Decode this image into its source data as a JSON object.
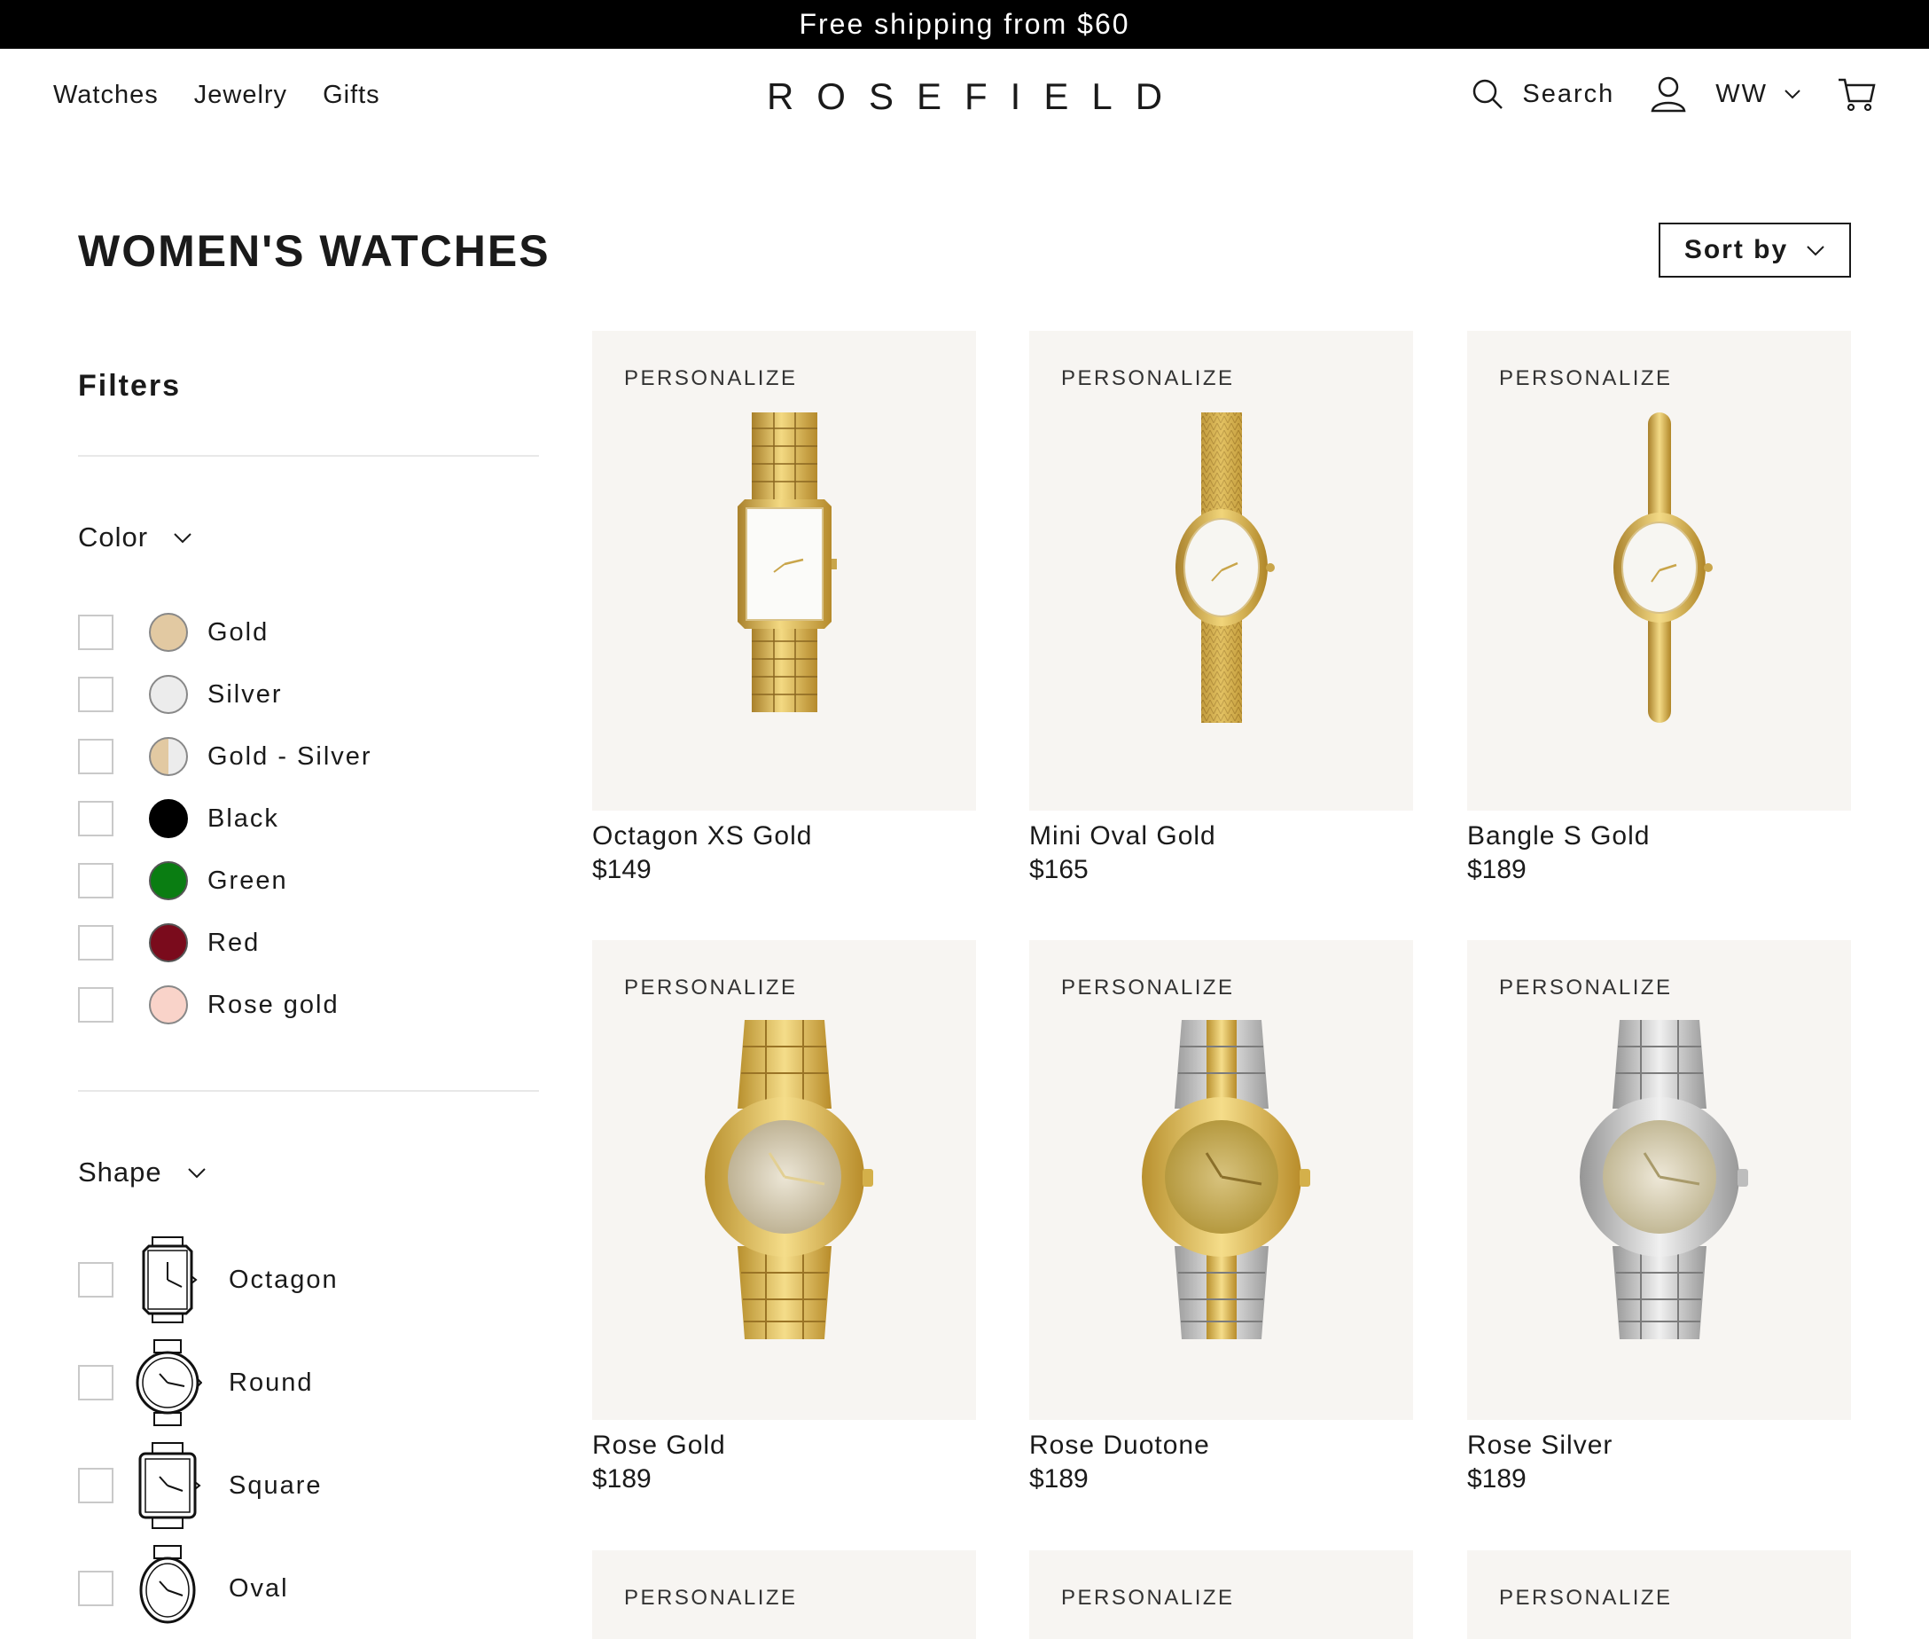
{
  "announcement": "Free shipping from $60",
  "nav": {
    "items": [
      "Watches",
      "Jewelry",
      "Gifts"
    ]
  },
  "logo": "ROSEFIELD",
  "header": {
    "search_label": "Search",
    "region": "WW"
  },
  "page": {
    "title": "WOMEN'S WATCHES",
    "sort_label": "Sort by"
  },
  "filters": {
    "title": "Filters",
    "color_heading": "Color",
    "colors": [
      {
        "label": "Gold",
        "swatch": "#e2c9a2"
      },
      {
        "label": "Silver",
        "swatch": "#ececec"
      },
      {
        "label": "Gold - Silver",
        "swatch": "split"
      },
      {
        "label": "Black",
        "swatch": "#000000"
      },
      {
        "label": "Green",
        "swatch": "#0a7d12"
      },
      {
        "label": "Red",
        "swatch": "#7a0b1c"
      },
      {
        "label": "Rose gold",
        "swatch": "#f9d3c9"
      }
    ],
    "shape_heading": "Shape",
    "shapes": [
      {
        "label": "Octagon",
        "icon": "octagon-watch-icon"
      },
      {
        "label": "Round",
        "icon": "round-watch-icon"
      },
      {
        "label": "Square",
        "icon": "square-watch-icon"
      },
      {
        "label": "Oval",
        "icon": "oval-watch-icon"
      }
    ]
  },
  "products": [
    {
      "badge": "PERSONALIZE",
      "name": "Octagon XS Gold",
      "price": "$149"
    },
    {
      "badge": "PERSONALIZE",
      "name": "Mini Oval Gold",
      "price": "$165"
    },
    {
      "badge": "PERSONALIZE",
      "name": "Bangle S Gold",
      "price": "$189"
    },
    {
      "badge": "PERSONALIZE",
      "name": "Rose Gold",
      "price": "$189"
    },
    {
      "badge": "PERSONALIZE",
      "name": "Rose Duotone",
      "price": "$189"
    },
    {
      "badge": "PERSONALIZE",
      "name": "Rose Silver",
      "price": "$189"
    },
    {
      "badge": "PERSONALIZE"
    },
    {
      "badge": "PERSONALIZE"
    },
    {
      "badge": "PERSONALIZE"
    }
  ],
  "colors": {
    "gold": "#d9b44a",
    "silver": "#c9c9c9",
    "card_bg": "#f7f5f2",
    "text": "#1a1a1a"
  }
}
